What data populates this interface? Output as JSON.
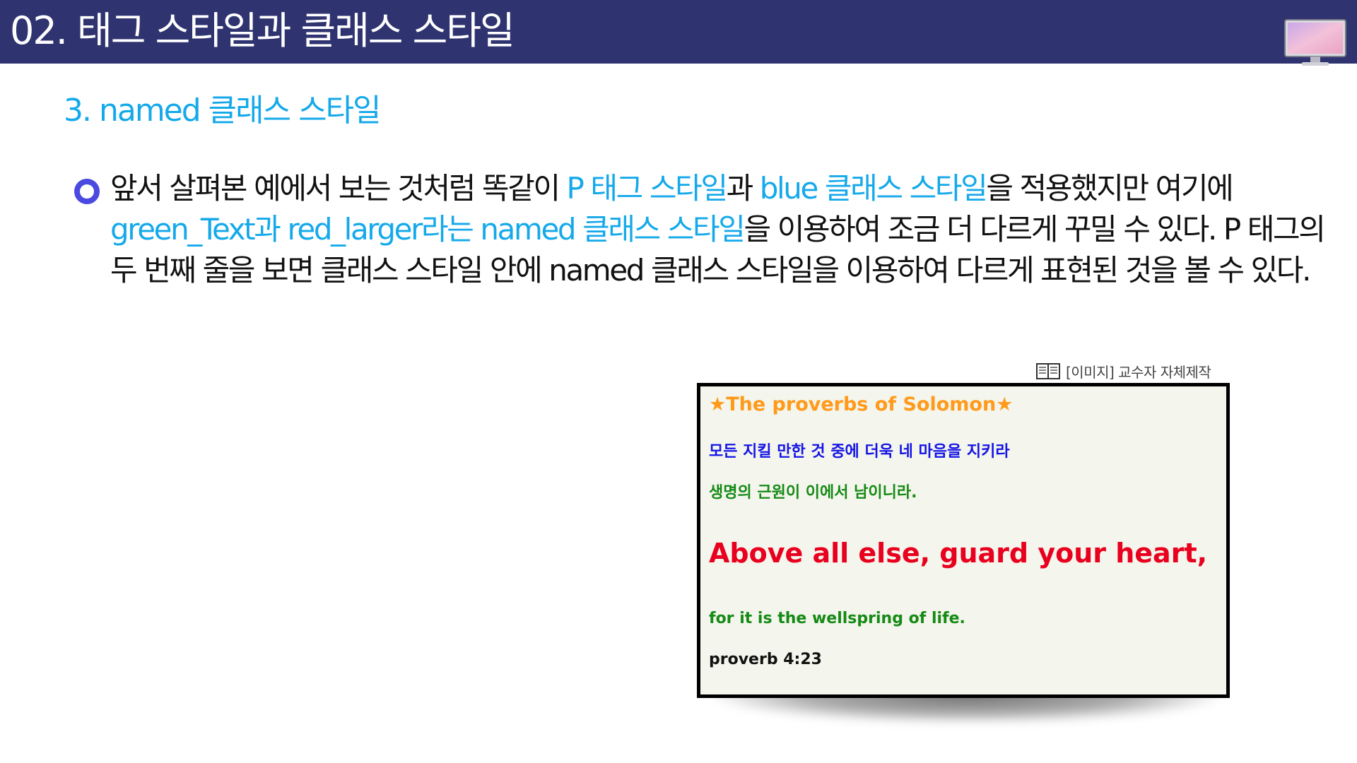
{
  "header": {
    "title": "02. 태그 스타일과 클래스 스타일",
    "bar_color": "#2f3471",
    "icon": "monitor-icon"
  },
  "section": {
    "heading": "3. named 클래스 스타일",
    "heading_color": "#15a9ea"
  },
  "body": {
    "bullet_icon": "circle-bullet-icon",
    "accent_color": "#15a9ea",
    "segments": [
      {
        "text": "앞서 살펴본 예에서 보는 것처럼 똑같이 ",
        "highlight": false
      },
      {
        "text": "P 태그 스타일",
        "highlight": true
      },
      {
        "text": "과 ",
        "highlight": false
      },
      {
        "text": "blue 클래스 스타일",
        "highlight": true
      },
      {
        "text": "을 적용했지만 여기에 ",
        "highlight": false
      },
      {
        "text": "green_Text과 red_larger라는 named 클래스 스타일",
        "highlight": true
      },
      {
        "text": "을 이용하여 조금 더 다르게 꾸밀 수 있다. P 태그의 두 번째 줄을 보면 클래스 스타일 안에 named 클래스 스타일을 이용하여 다르게 표현된 것을 볼 수 있다.",
        "highlight": false
      }
    ]
  },
  "caption": {
    "icon": "book-icon",
    "text": "[이미지] 교수자 자체제작"
  },
  "sample": {
    "background": "#f4f5ec",
    "lines": [
      {
        "text": "★The proverbs of Solomon★",
        "color": "#ff9a1a"
      },
      {
        "text": "모든 지킬 만한 것 중에 더욱 네 마음을 지키라",
        "color": "#1414e6"
      },
      {
        "text": "생명의 근원이 이에서 남이니라.",
        "color": "#158a15"
      },
      {
        "text": "Above all else, guard your heart,",
        "color": "#e8001e"
      },
      {
        "text": "for it is the wellspring of life.",
        "color": "#158a15"
      },
      {
        "text": "proverb 4:23",
        "color": "#111111"
      }
    ]
  }
}
